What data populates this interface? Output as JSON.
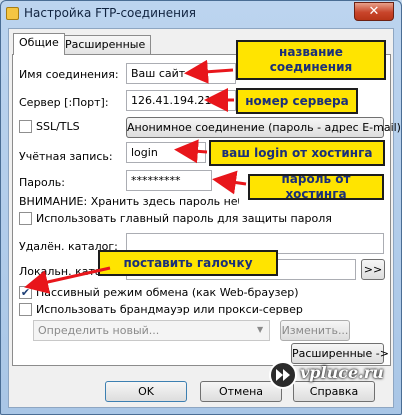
{
  "window": {
    "title": "Настройка FTP-соединения",
    "close_glyph": "✕"
  },
  "tabs": [
    {
      "label": "Общие",
      "active": true
    },
    {
      "label": "Расширенные",
      "active": false
    }
  ],
  "form": {
    "connection_name_label": "Имя соединения:",
    "connection_name_value": "Ваш сайт",
    "server_label": "Сервер [:Порт]:",
    "server_value": "126.41.194.211",
    "ssl_label": "SSL/TLS",
    "anon_button": "Анонимное соединение (пароль - адрес E-mail)",
    "account_label": "Учётная запись:",
    "account_value": "login",
    "password_label": "Пароль:",
    "password_value": "*********",
    "warning_text": "ВНИМАНИЕ: Хранить здесь пароль небезопасно!",
    "master_password_label": "Использовать главный пароль для защиты пароля",
    "remote_dir_label": "Удалён. каталог:",
    "remote_dir_value": "",
    "local_dir_label": "Локальн. каталог:",
    "local_dir_value": "",
    "browse_button": ">>",
    "passive_label": "Пассивный режим обмена (как Web-браузер)",
    "passive_checked": true,
    "firewall_label": "Использовать брандмауэр или прокси-сервер",
    "firewall_select": "Определить новый...",
    "change_button": "Изменить...",
    "advanced_button": "Расширенные ->"
  },
  "footer": {
    "ok": "OK",
    "cancel": "Отмена",
    "help": "Справка"
  },
  "callouts": {
    "name": "название соединения",
    "server": "номер сервера",
    "login": "ваш login от хостинга",
    "password": "пароль от хостинга",
    "passive": "поставить галочку"
  },
  "colors": {
    "callout_bg": "#ffe400",
    "arrow": "#e8161b",
    "callout_text": "#1a2f7a"
  },
  "watermark": {
    "text": "vpluce.ru"
  }
}
